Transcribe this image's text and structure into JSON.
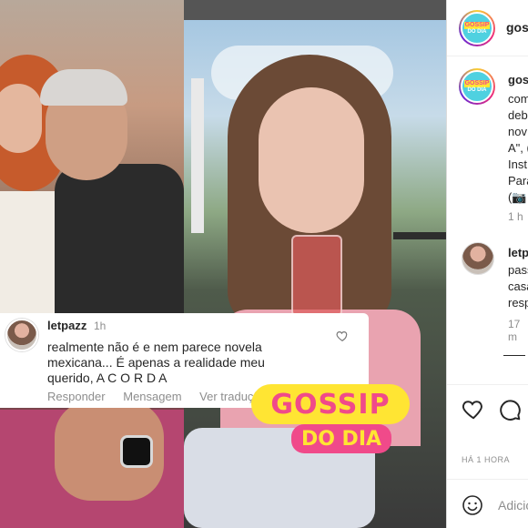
{
  "post_comment": {
    "username": "letpazz",
    "time": "1h",
    "text_line1": "realmente não é e nem parece novela",
    "text_line2": "mexicana... É apenas a realidade meu",
    "text_line3": "querido, A C O R D A",
    "action_reply": "Responder",
    "action_message": "Mensagem",
    "action_translate": "Ver tradução",
    "like_icon": "heart-outline-icon"
  },
  "watermark": {
    "line1": "GOSSIP",
    "line2": "DO DIA"
  },
  "sidebar": {
    "username": "goss",
    "avatar_line1": "GOSSIP",
    "avatar_line2": "DO DIA",
    "caption": {
      "username": "gossi",
      "lines": [
        "com",
        "deb",
        "nov",
        "A\", (",
        "Inst",
        "Para",
        "(📷"
      ],
      "time": "1 h"
    },
    "comment": {
      "username": "letp",
      "lines": [
        "pass",
        "casa",
        "resp"
      ],
      "time": "17 m"
    },
    "date": "HÁ 1 HORA",
    "add_comment_placeholder": "Adicio"
  },
  "colors": {
    "brand_yellow": "#ffe533",
    "brand_pink": "#f04a8a",
    "brand_teal": "#4fd1e0",
    "text_primary": "#262626",
    "text_secondary": "#8e8e8e"
  }
}
